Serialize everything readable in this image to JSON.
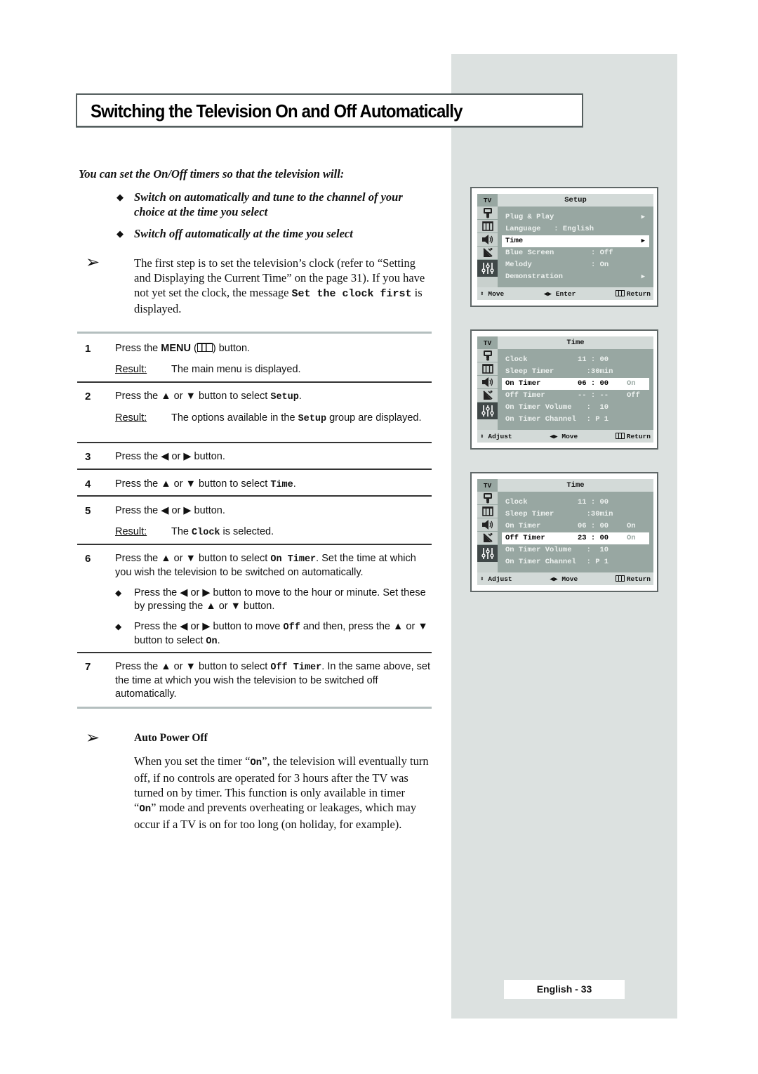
{
  "title": "Switching the Television On and Off Automatically",
  "intro": {
    "heading": "You can set the On/Off timers so that the television will:",
    "bullets": [
      "Switch on automatically and tune to the channel of your choice at the time you select",
      "Switch off automatically at the time you select"
    ],
    "note_pre": "The first step is to set the television’s clock (refer to “Setting and Displaying the Current Time” on the page 31). If you have not yet set the clock, the message ",
    "note_code": "Set the clock first",
    "note_post": " is displayed."
  },
  "steps": [
    {
      "num": "1",
      "pre": "Press the ",
      "bold": "MENU",
      "mid": " (",
      "icon": "menu-icon",
      "post": ") button.",
      "result_label": "Result:",
      "result": "The main menu is displayed."
    },
    {
      "num": "2",
      "pre": "Press the ▲ or ▼ button to select ",
      "code": "Setup",
      "post": ".",
      "result_label": "Result:",
      "result_pre": "The options available in the ",
      "result_code": "Setup",
      "result_post": " group are displayed."
    },
    {
      "num": "3",
      "text": "Press the ◀ or ▶ button."
    },
    {
      "num": "4",
      "pre": "Press the ▲ or ▼ button to select ",
      "code": "Time",
      "post": "."
    },
    {
      "num": "5",
      "text": "Press the ◀ or ▶ button.",
      "result_label": "Result:",
      "result_pre": "The ",
      "result_code": "Clock",
      "result_post": " is selected."
    },
    {
      "num": "6",
      "pre": "Press the ▲ or ▼ button to select ",
      "code": "On Timer",
      "post": ". Set the time at which you wish the television to be switched on automatically.",
      "subs": [
        {
          "text": "Press the ◀ or ▶ button to move to the hour or minute. Set these by pressing the ▲ or ▼ button."
        },
        {
          "pre": "Press the ◀ or ▶ button to move ",
          "code": "Off",
          "mid": " and then, press the ▲ or ▼ button to select ",
          "code2": "On",
          "post": "."
        }
      ]
    },
    {
      "num": "7",
      "pre": "Press the ▲ or ▼ button to select ",
      "code": "Off Timer",
      "post": ". In the same above, set the time at which you wish the television to be switched off automatically."
    }
  ],
  "auto_power_off": {
    "heading": "Auto Power Off",
    "p1": "When you set the timer “",
    "code1": "On",
    "p2": "”, the television will eventually turn off, if no controls are operated for 3 hours after the TV was turned on by timer. This function is only available in timer “",
    "code2": "On",
    "p3": "” mode and prevents overheating or leakages, which may occur if a TV is on for too long (on holiday, for example)."
  },
  "osd_screens": [
    {
      "tv_label": "TV",
      "title": "Setup",
      "rows": [
        {
          "label": "Plug & Play",
          "value": "",
          "arrow": "▶",
          "highlight": false
        },
        {
          "label": "Language   : English",
          "value": "",
          "highlight": false
        },
        {
          "label": "Time",
          "value": "",
          "arrow": "▶",
          "highlight": true
        },
        {
          "label": "Blue Screen",
          "value": ": Off",
          "highlight": false
        },
        {
          "label": "Melody",
          "value": ": On",
          "highlight": false
        },
        {
          "label": "Demonstration",
          "value": "",
          "arrow": "▶",
          "highlight": false
        }
      ],
      "footer": {
        "left": "⬍ Move",
        "mid": "◀▶ Enter",
        "right": "Return"
      }
    },
    {
      "tv_label": "TV",
      "title": "Time",
      "rows": [
        {
          "label": "Clock",
          "value": "11 : 00",
          "extra": "",
          "highlight": false
        },
        {
          "label": "Sleep Timer",
          "value": "  :30min",
          "extra": "",
          "highlight": false
        },
        {
          "label": "On Timer",
          "value": "06 : 00",
          "extra": "On",
          "extra_dim": true,
          "highlight": true
        },
        {
          "label": "Off Timer",
          "value": "-- : --",
          "extra": "Off",
          "highlight": false
        },
        {
          "label": "On Timer Volume",
          "value": "  :  10",
          "extra": "",
          "highlight": false
        },
        {
          "label": "On Timer Channel",
          "value": "  : P 1",
          "extra": "",
          "highlight": false
        }
      ],
      "footer": {
        "left": "⬍ Adjust",
        "mid": "◀▶ Move",
        "right": "Return"
      }
    },
    {
      "tv_label": "TV",
      "title": "Time",
      "rows": [
        {
          "label": "Clock",
          "value": "11 : 00",
          "extra": "",
          "highlight": false
        },
        {
          "label": "Sleep Timer",
          "value": "  :30min",
          "extra": "",
          "highlight": false
        },
        {
          "label": "On Timer",
          "value": "06 : 00",
          "extra": "On",
          "highlight": false
        },
        {
          "label": "Off Timer",
          "value": "23 : 00",
          "extra": "On",
          "extra_dim": true,
          "highlight": true
        },
        {
          "label": "On Timer Volume",
          "value": "  :  10",
          "extra": "",
          "highlight": false
        },
        {
          "label": "On Timer Channel",
          "value": "  : P 1",
          "extra": "",
          "highlight": false
        }
      ],
      "footer": {
        "left": "⬍ Adjust",
        "mid": "◀▶ Move",
        "right": "Return"
      }
    }
  ],
  "osd_icons": [
    "picture-icon",
    "menu-channel-icon",
    "sound-icon",
    "antenna-icon",
    "setup-sliders-icon"
  ],
  "page_number": "English - 33"
}
